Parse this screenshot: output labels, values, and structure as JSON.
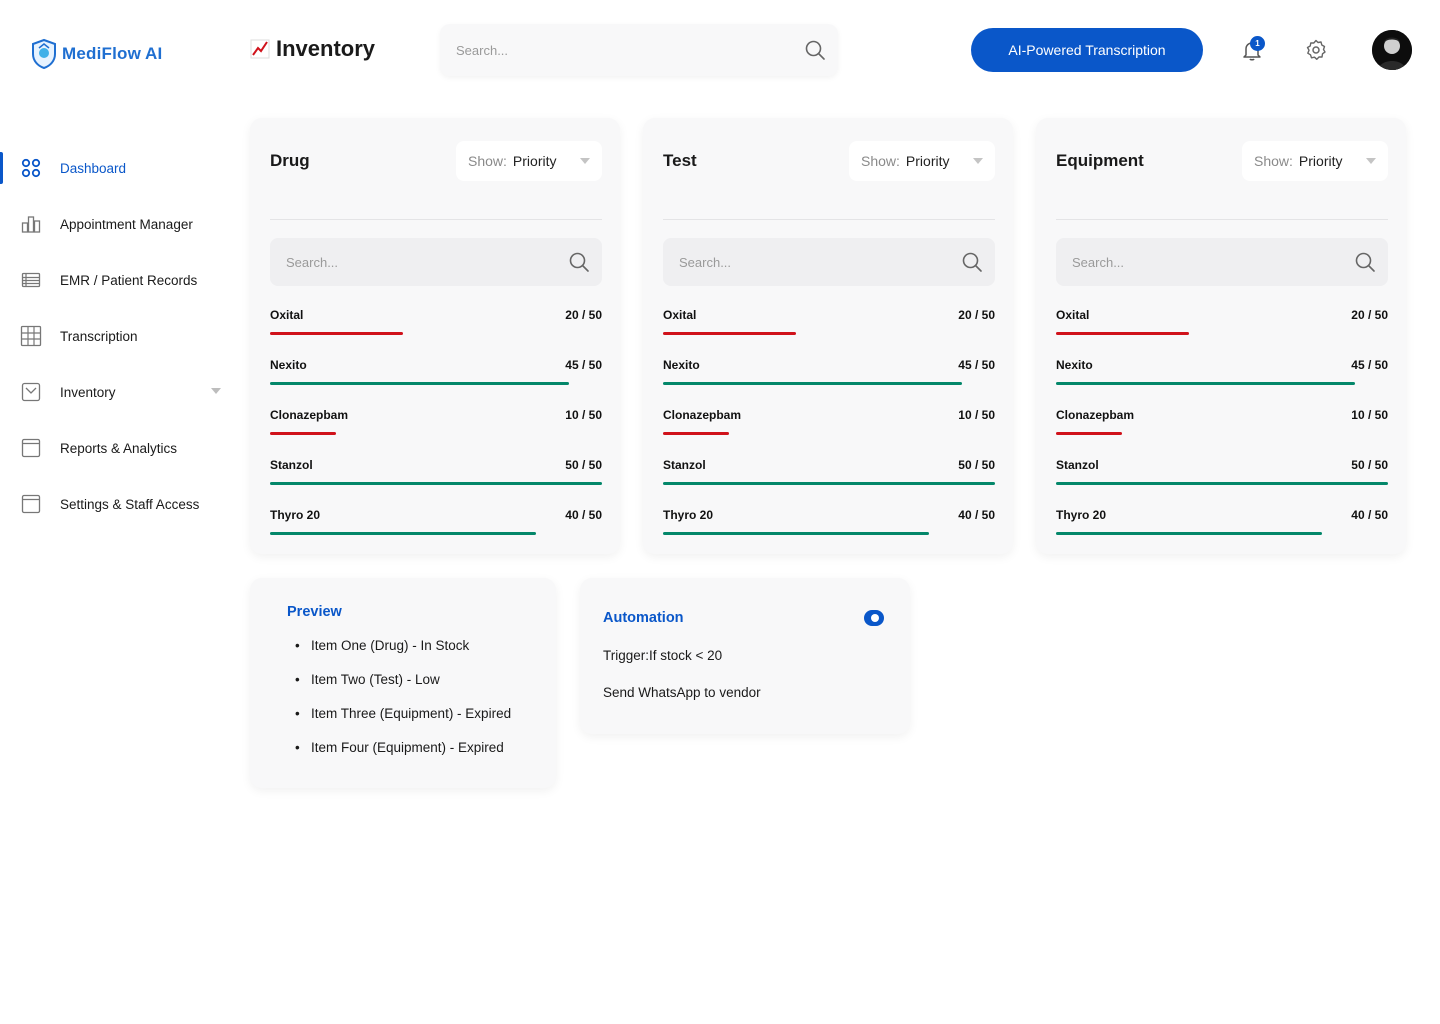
{
  "app": {
    "logo_name": "MediFlow",
    "logo_suffix": "AI"
  },
  "header": {
    "title": "Inventory",
    "search_placeholder": "Search...",
    "ai_button_label": "AI-Powered Transcription",
    "notification_count": "1"
  },
  "sidebar": {
    "items": [
      {
        "label": "Dashboard",
        "icon": "grid-icon",
        "active": true
      },
      {
        "label": "Appointment Manager",
        "icon": "bar-chart-icon"
      },
      {
        "label": "EMR / Patient Records",
        "icon": "list-icon"
      },
      {
        "label": "Transcription",
        "icon": "table-icon"
      },
      {
        "label": "Inventory",
        "icon": "inbox-icon"
      },
      {
        "label": "Reports & Analytics",
        "icon": "window-icon"
      },
      {
        "label": "Settings & Staff Access",
        "icon": "window-icon"
      }
    ]
  },
  "cards": [
    {
      "title": "Drug",
      "show_label": "Show:",
      "show_value": "Priority",
      "search_placeholder": "Search...",
      "rows": [
        {
          "name": "Oxital",
          "value": "20 / 50",
          "fraction": 0.4,
          "status": "low"
        },
        {
          "name": "Nexito",
          "value": "45 / 50",
          "fraction": 0.9,
          "status": "ok"
        },
        {
          "name": "Clonazepbam",
          "value": "10 / 50",
          "fraction": 0.2,
          "status": "low"
        },
        {
          "name": "Stanzol",
          "value": "50 / 50",
          "fraction": 1.0,
          "status": "ok"
        },
        {
          "name": "Thyro 20",
          "value": "40 / 50",
          "fraction": 0.8,
          "status": "ok"
        }
      ]
    },
    {
      "title": "Test",
      "show_label": "Show:",
      "show_value": "Priority",
      "search_placeholder": "Search...",
      "rows": [
        {
          "name": "Oxital",
          "value": "20 / 50",
          "fraction": 0.4,
          "status": "low"
        },
        {
          "name": "Nexito",
          "value": "45 / 50",
          "fraction": 0.9,
          "status": "ok"
        },
        {
          "name": "Clonazepbam",
          "value": "10 / 50",
          "fraction": 0.2,
          "status": "low"
        },
        {
          "name": "Stanzol",
          "value": "50 / 50",
          "fraction": 1.0,
          "status": "ok"
        },
        {
          "name": "Thyro 20",
          "value": "40 / 50",
          "fraction": 0.8,
          "status": "ok"
        }
      ]
    },
    {
      "title": "Equipment",
      "show_label": "Show:",
      "show_value": "Priority",
      "search_placeholder": "Search...",
      "rows": [
        {
          "name": "Oxital",
          "value": "20 / 50",
          "fraction": 0.4,
          "status": "low"
        },
        {
          "name": "Nexito",
          "value": "45 / 50",
          "fraction": 0.9,
          "status": "ok"
        },
        {
          "name": "Clonazepbam",
          "value": "10 / 50",
          "fraction": 0.2,
          "status": "low"
        },
        {
          "name": "Stanzol",
          "value": "50 / 50",
          "fraction": 1.0,
          "status": "ok"
        },
        {
          "name": "Thyro 20",
          "value": "40 / 50",
          "fraction": 0.8,
          "status": "ok"
        }
      ]
    }
  ],
  "preview": {
    "title": "Preview",
    "items": [
      "Item One (Drug) - In Stock",
      "Item Two (Test) - Low",
      "Item Three (Equipment) - Expired",
      "Item Four (Equipment) - Expired"
    ]
  },
  "automation": {
    "title": "Automation",
    "enabled": true,
    "trigger": "Trigger:If stock < 20",
    "action": "Send WhatsApp to vendor"
  },
  "colors": {
    "accent": "#0a57c9",
    "low": "#d0121b",
    "ok": "#04876a"
  }
}
